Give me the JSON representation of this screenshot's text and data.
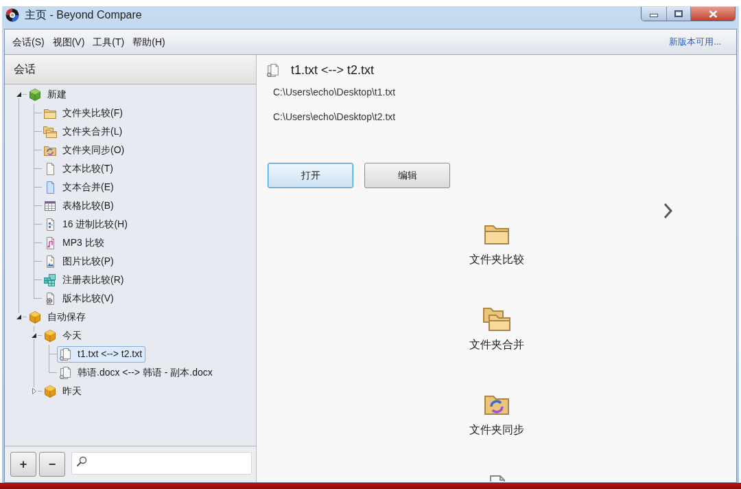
{
  "window": {
    "title": "主页 - Beyond Compare"
  },
  "menu_bar": {
    "items": [
      "会话(S)",
      "视图(V)",
      "工具(T)",
      "帮助(H)"
    ],
    "update_link": "新版本可用..."
  },
  "sidebar": {
    "title": "会话",
    "tree": [
      {
        "label": "新建",
        "kind": "new",
        "expanded": true,
        "selected": false,
        "children": [
          {
            "label": "文件夹比较(F)",
            "kind": "folder",
            "selected": false
          },
          {
            "label": "文件夹合并(L)",
            "kind": "folders",
            "selected": false
          },
          {
            "label": "文件夹同步(O)",
            "kind": "foldersync",
            "selected": false
          },
          {
            "label": "文本比较(T)",
            "kind": "text",
            "selected": false
          },
          {
            "label": "文本合并(E)",
            "kind": "textmerge",
            "selected": false
          },
          {
            "label": "表格比较(B)",
            "kind": "table",
            "selected": false
          },
          {
            "label": "16 进制比较(H)",
            "kind": "hex",
            "selected": false
          },
          {
            "label": "MP3 比较",
            "kind": "mp3",
            "selected": false
          },
          {
            "label": "图片比较(P)",
            "kind": "picture",
            "selected": false
          },
          {
            "label": "注册表比较(R)",
            "kind": "registry",
            "selected": false
          },
          {
            "label": "版本比较(V)",
            "kind": "version",
            "selected": false
          }
        ]
      },
      {
        "label": "自动保存",
        "kind": "group",
        "expanded": true,
        "selected": false,
        "children": [
          {
            "label": "今天",
            "kind": "group",
            "expanded": true,
            "selected": false,
            "children": [
              {
                "label": "t1.txt <--> t2.txt",
                "kind": "session",
                "selected": true
              },
              {
                "label": "韩语.docx <--> 韩语 - 副本.docx",
                "kind": "session",
                "selected": false
              }
            ]
          },
          {
            "label": "昨天",
            "kind": "group",
            "expanded": false,
            "selected": false
          }
        ]
      }
    ],
    "buttons": [
      "+",
      "−"
    ]
  },
  "details": {
    "title": "t1.txt <--> t2.txt",
    "paths": [
      "C:\\Users\\echo\\Desktop\\t1.txt",
      "C:\\Users\\echo\\Desktop\\t2.txt"
    ],
    "buttons": [
      {
        "label": "打开",
        "focused": true
      },
      {
        "label": "编辑",
        "focused": false
      }
    ],
    "tiles": [
      {
        "label": "文件夹比较",
        "kind": "folder"
      },
      {
        "label": "文件夹合并",
        "kind": "folders"
      },
      {
        "label": "文件夹同步",
        "kind": "foldersync"
      },
      {
        "kind": "text"
      }
    ]
  }
}
